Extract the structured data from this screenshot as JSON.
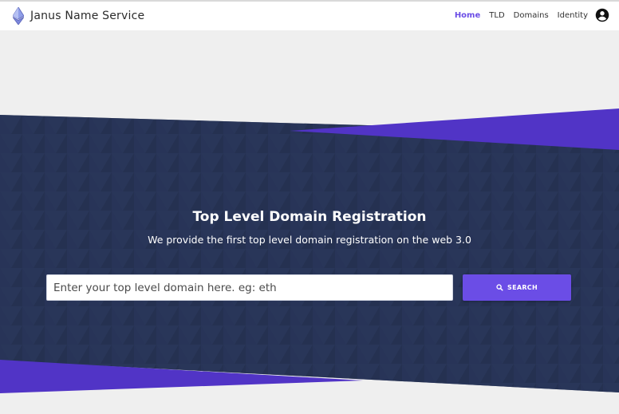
{
  "header": {
    "brand_name": "Janus Name Service",
    "logo_icon": "ethereum-logo-icon",
    "nav": {
      "home": "Home",
      "tld": "TLD",
      "domains": "Domains",
      "identity": "Identity"
    },
    "account_icon": "account-circle-icon"
  },
  "hero": {
    "title": "Top Level Domain Registration",
    "subtitle": "We provide the first top level domain registration on the web 3.0",
    "search_placeholder": "Enter your top level domain here. eg: eth",
    "search_button_label": "SEARCH",
    "search_icon": "search-icon"
  },
  "colors": {
    "accent": "#6b4de6",
    "hero_background": "#273355",
    "page_background": "#efefef"
  }
}
